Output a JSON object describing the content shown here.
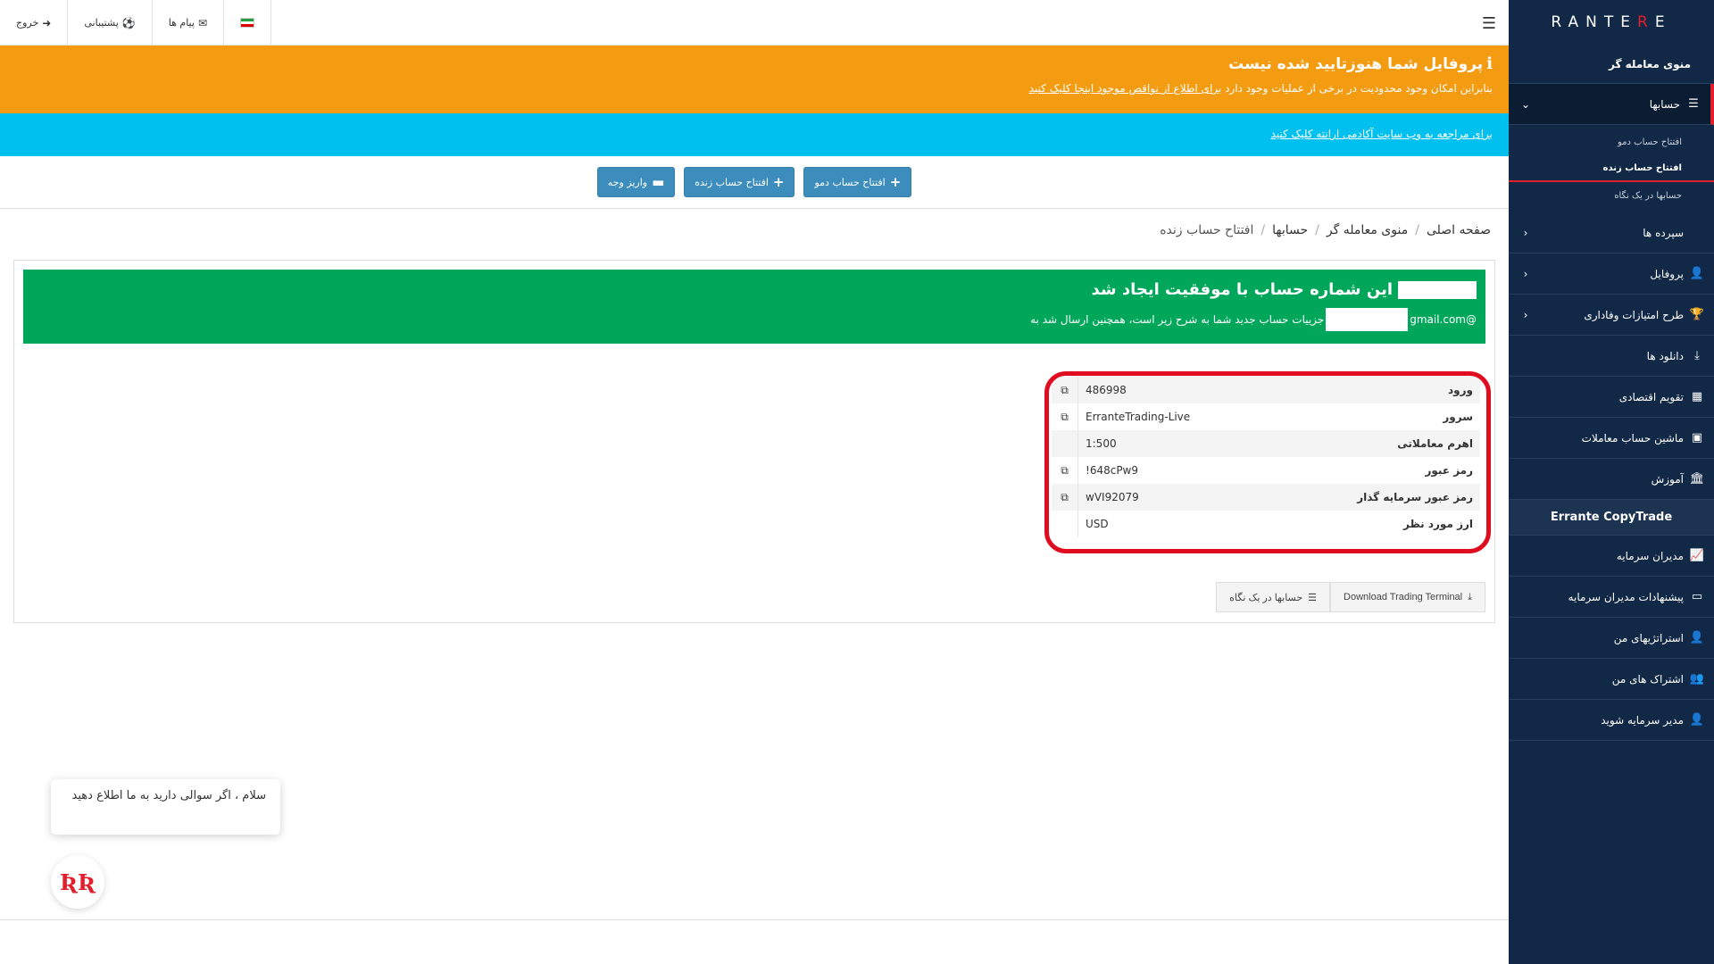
{
  "sidebar": {
    "logo": {
      "pre": "E",
      "r": "R",
      "post": "RANTE"
    },
    "header": "منوی معامله گر",
    "accounts": {
      "label": "حسابها",
      "icon": "list-icon"
    },
    "sub_items": [
      "افتتاح حساب دمو",
      "افتتاح حساب زنده",
      "حسابها در یک نگاه"
    ],
    "items": [
      {
        "label": "سپرده ها",
        "icon": "chevron-icon"
      },
      {
        "label": "پروفایل",
        "icon": "user-icon"
      },
      {
        "label": "طرح امتیازات وفاداری",
        "icon": "trophy-icon"
      },
      {
        "label": "دانلود ها",
        "icon": "download-icon"
      },
      {
        "label": "تقویم اقتصادی",
        "icon": "calendar-icon"
      },
      {
        "label": "ماشین حساب معاملات",
        "icon": "calculator-icon"
      },
      {
        "label": "آموزش",
        "icon": "bank-icon"
      }
    ],
    "copytrade_title": "Errante CopyTrade",
    "copy_items": [
      {
        "label": "مدیران سرمایه",
        "icon": "chart-icon"
      },
      {
        "label": "پیشنهادات مدیران سرمایه",
        "icon": "card-icon"
      },
      {
        "label": "استراتژیهای من",
        "icon": "user-icon"
      },
      {
        "label": "اشتراک های من",
        "icon": "users-icon"
      },
      {
        "label": "مدیر سرمایه شوید",
        "icon": "user-plus-icon"
      }
    ]
  },
  "topbar": {
    "logout": "خروج",
    "support": "پشتیبانی",
    "messages": "پیام ها"
  },
  "banners": {
    "profile_title": "پروفایل شما هنوزتایید شده نیست",
    "profile_text_plain": "بنابراین امکان وجود محدودیت در برخی از عملیات وجود دارد ",
    "profile_text_link": "برای اطلاع از نواقص موجود اینجا کلیک کنید",
    "academy_link": "برای مراجعه به وب سایت آکادمی ارانته کلیک کنید"
  },
  "actions": {
    "demo": "افتتاح حساب دمو",
    "live": "افتتاح حساب زنده",
    "deposit": "واریز وجه"
  },
  "breadcrumb": {
    "home": "صفحه اصلی",
    "trader": "منوی معامله گر",
    "accounts": "حسابها",
    "current": "افتتاح حساب زنده"
  },
  "success": {
    "title": "این شماره حساب با موفقیت ایجاد شد",
    "email_suffix": "@gmail.com",
    "text": "جزییات حساب جدید شما به شرح زیر است، همچنین ارسال شد به"
  },
  "details": [
    {
      "label": "ورود",
      "value": "486998",
      "copy": true
    },
    {
      "label": "سرور",
      "value": "ErranteTrading-Live",
      "copy": true
    },
    {
      "label": "اهرم معاملاتی",
      "value": "1:500",
      "copy": false
    },
    {
      "label": "رمز عبور",
      "value": "648cPw9!",
      "copy": true
    },
    {
      "label": "رمز عبور سرمایه گذار",
      "value": "wVI92079",
      "copy": true
    },
    {
      "label": "ارز مورد نظر",
      "value": "USD",
      "copy": false
    }
  ],
  "buttons": {
    "download": "Download Trading Terminal",
    "overview": "حسابها در یک نگاه"
  },
  "chat": {
    "message": "سلام ، اگر سوالی دارید به ما اطلاع دهید"
  },
  "colors": {
    "sidebar": "#112946",
    "orange": "#f39c12",
    "blue": "#00c0ef",
    "green": "#00a65a",
    "accent": "#e21f2d"
  }
}
